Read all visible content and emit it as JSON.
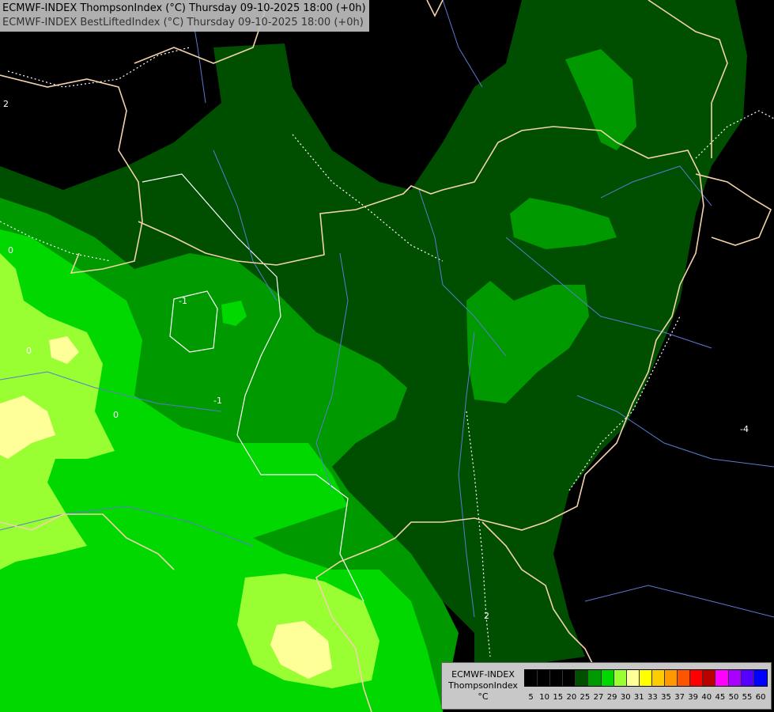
{
  "header": {
    "line1": "ECMWF-INDEX ThompsonIndex (°C) Thursday 09-10-2025 18:00 (+0h)",
    "line2": "ECMWF-INDEX BestLiftedIndex (°C) Thursday 09-10-2025 18:00 (+0h)"
  },
  "legend": {
    "line1": "ECMWF-INDEX",
    "line2": "ThompsonIndex",
    "line3": "°C",
    "classes": [
      {
        "label": "5",
        "color": "#000000"
      },
      {
        "label": "10",
        "color": "#000000"
      },
      {
        "label": "15",
        "color": "#000000"
      },
      {
        "label": "20",
        "color": "#000000"
      },
      {
        "label": "25",
        "color": "#004f00"
      },
      {
        "label": "27",
        "color": "#009900"
      },
      {
        "label": "29",
        "color": "#00d800"
      },
      {
        "label": "30",
        "color": "#99ff33"
      },
      {
        "label": "31",
        "color": "#ffff99"
      },
      {
        "label": "33",
        "color": "#ffff00"
      },
      {
        "label": "35",
        "color": "#ffcc00"
      },
      {
        "label": "37",
        "color": "#ff9900"
      },
      {
        "label": "39",
        "color": "#ff5500"
      },
      {
        "label": "40",
        "color": "#ff0000"
      },
      {
        "label": "45",
        "color": "#bb0000"
      },
      {
        "label": "50",
        "color": "#ff00ff"
      },
      {
        "label": "55",
        "color": "#aa00ff"
      },
      {
        "label": "60",
        "color": "#5500ff"
      },
      {
        "label": "",
        "color": "#0000ff"
      }
    ]
  },
  "contour_labels": [
    "2",
    "0",
    "0",
    "-1",
    "0",
    "2",
    "-1",
    "-4"
  ],
  "colors": {
    "background": "#000000",
    "level_25": "#004f00",
    "level_27": "#009900",
    "level_29": "#00d800",
    "level_30": "#99ff33",
    "level_31": "#ffff99",
    "border": "#f2d2a9",
    "river": "#5a7ad0",
    "isoline": "#ffffff"
  }
}
